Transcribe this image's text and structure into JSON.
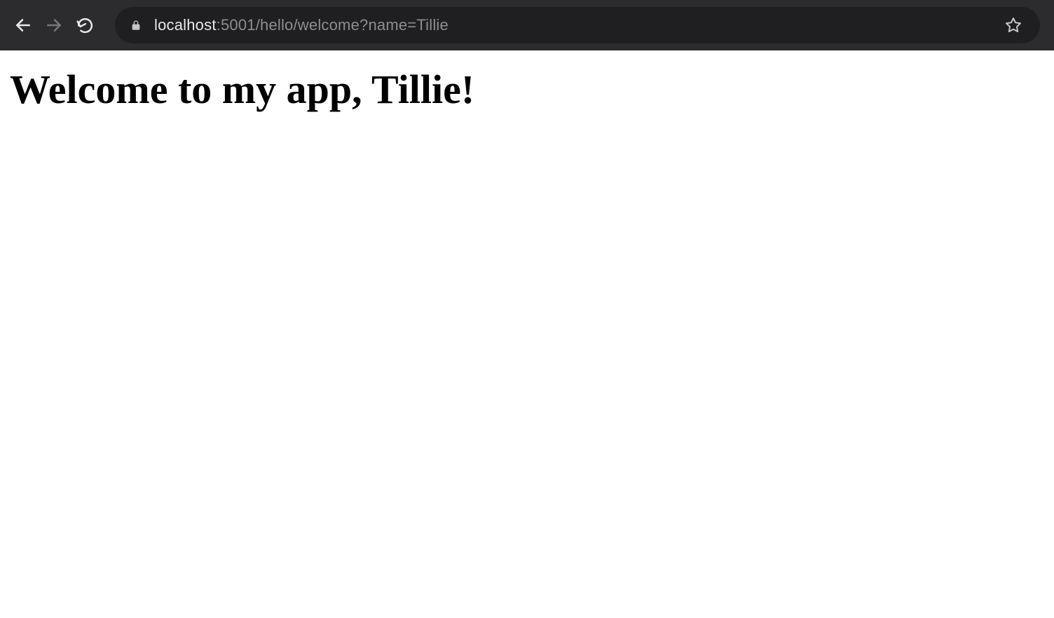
{
  "browser": {
    "url": {
      "host": "localhost",
      "path": ":5001/hello/welcome?name=Tillie"
    }
  },
  "page": {
    "heading": "Welcome to my app, Tillie!"
  }
}
